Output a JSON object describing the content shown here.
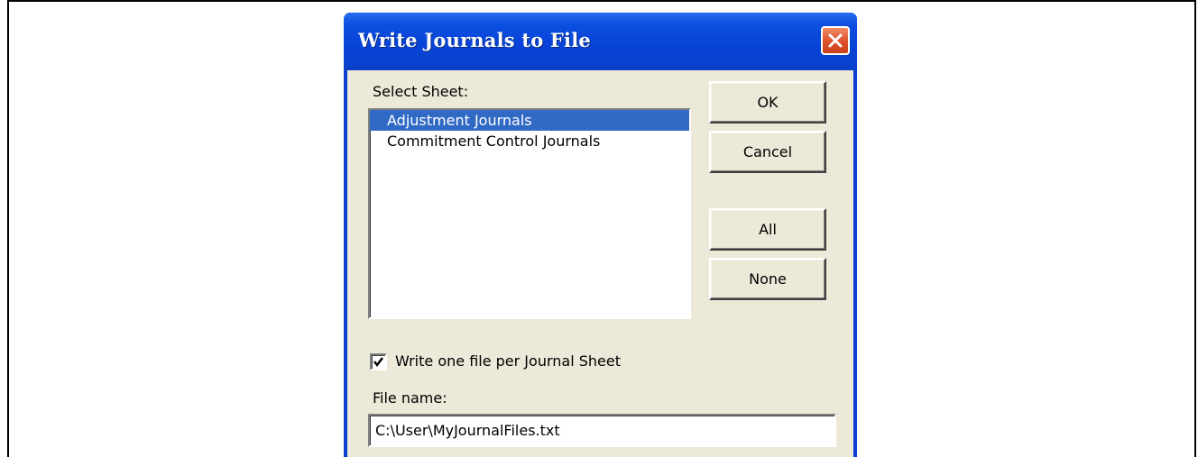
{
  "dialog": {
    "title": "Write Journals to File",
    "close_icon": "close-icon",
    "select_sheet_label": "Select Sheet:",
    "sheets": [
      {
        "label": "Adjustment Journals",
        "selected": true
      },
      {
        "label": "Commitment Control Journals",
        "selected": false
      }
    ],
    "buttons": {
      "ok": "OK",
      "cancel": "Cancel",
      "all": "All",
      "none": "None"
    },
    "write_one_file": {
      "label": "Write one file per Journal Sheet",
      "checked": true
    },
    "file_name_label": "File name:",
    "file_name_value": "C:\\User\\MyJournalFiles.txt"
  },
  "colors": {
    "titlebar": "#0743d6",
    "close_button": "#e0542c",
    "dialog_face": "#ece9d8",
    "selection": "#316ac5"
  }
}
